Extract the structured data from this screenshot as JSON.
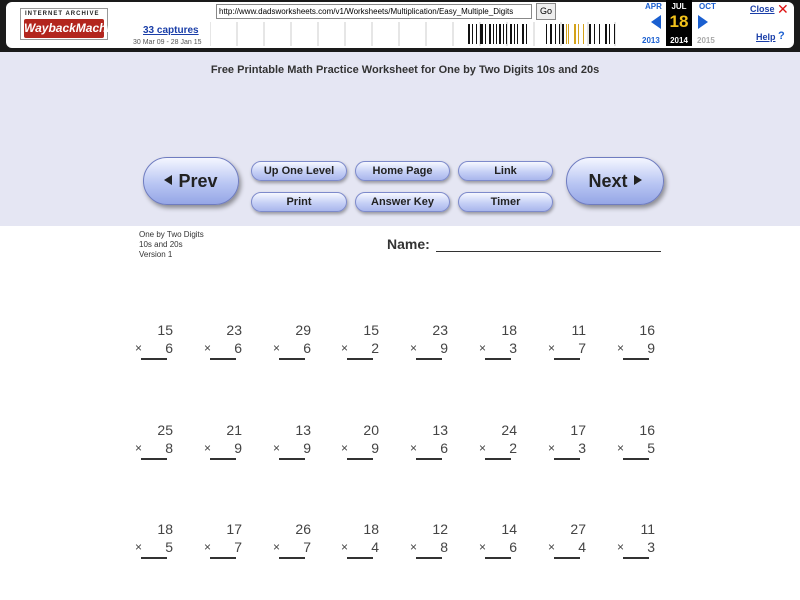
{
  "wayback": {
    "logo_top": "INTERNET ARCHIVE",
    "logo_main": "WaybackMachine",
    "captures": "33 captures",
    "range": "30 Mar 09 - 28 Jan 15",
    "url": "http://www.dadsworksheets.com/v1/Worksheets/Multiplication/Easy_Multiple_Digits",
    "go": "Go",
    "prev_month": "APR",
    "cur_month": "JUL",
    "next_month": "OCT",
    "cur_day": "18",
    "prev_year": "2013",
    "cur_year": "2014",
    "next_year": "2015",
    "close": "Close",
    "help": "Help",
    "accent": "#1a5fd0"
  },
  "header": {
    "title": "Free Printable Math Practice Worksheet for One by Two Digits 10s and 20s",
    "prev": "Prev",
    "next": "Next",
    "buttons": [
      {
        "id": "up-one-level",
        "label": "Up One Level"
      },
      {
        "id": "home-page",
        "label": "Home Page"
      },
      {
        "id": "link",
        "label": "Link"
      },
      {
        "id": "print",
        "label": "Print"
      },
      {
        "id": "answer-key",
        "label": "Answer Key"
      },
      {
        "id": "timer",
        "label": "Timer"
      }
    ]
  },
  "worksheet": {
    "meta": [
      "One by Two Digits",
      "10s and 20s",
      "Version 1"
    ],
    "name_label": "Name:",
    "operator": "×",
    "problems": [
      [
        [
          15,
          6
        ],
        [
          23,
          6
        ],
        [
          29,
          6
        ],
        [
          15,
          2
        ],
        [
          23,
          9
        ],
        [
          18,
          3
        ],
        [
          11,
          7
        ],
        [
          16,
          9
        ]
      ],
      [
        [
          25,
          8
        ],
        [
          21,
          9
        ],
        [
          13,
          9
        ],
        [
          20,
          9
        ],
        [
          13,
          6
        ],
        [
          24,
          2
        ],
        [
          17,
          3
        ],
        [
          16,
          5
        ]
      ],
      [
        [
          18,
          5
        ],
        [
          17,
          7
        ],
        [
          26,
          7
        ],
        [
          18,
          4
        ],
        [
          12,
          8
        ],
        [
          14,
          6
        ],
        [
          27,
          4
        ],
        [
          11,
          3
        ]
      ]
    ]
  }
}
